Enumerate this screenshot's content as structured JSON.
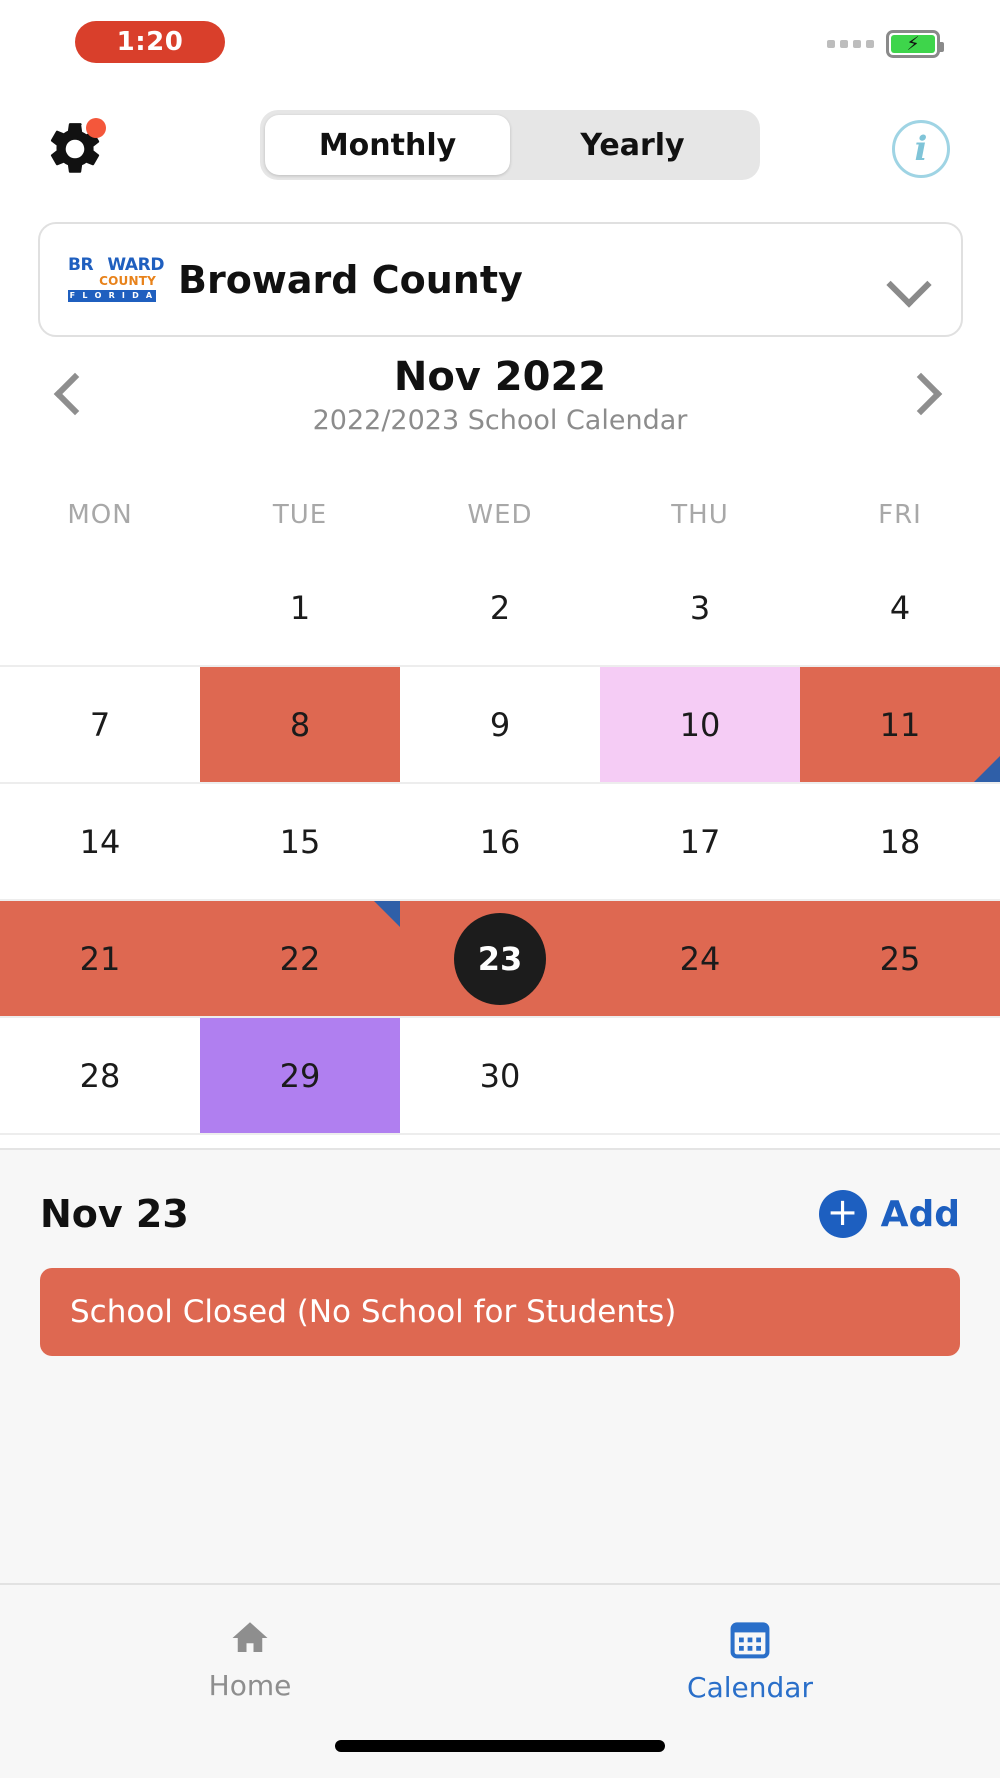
{
  "status_bar": {
    "time": "1:20",
    "time_pill_color": "#D93F2B",
    "battery_color": "#3ED54B",
    "charging": true,
    "signal_dots": 4
  },
  "header": {
    "gear_icon": "gear-icon",
    "gear_badge": true,
    "info_icon": "info-icon",
    "segments": [
      {
        "label": "Monthly",
        "active": true
      },
      {
        "label": "Yearly",
        "active": false
      }
    ]
  },
  "county_selector": {
    "name": "Broward County",
    "logo": {
      "line1": "BR",
      "line1b": "WARD",
      "line2": "COUNTY",
      "line3": "F L O R I D A",
      "blue": "#1F5FBF",
      "orange": "#E8821A",
      "sun": "#FFC214"
    },
    "chevron_icon": "chevron-down-icon"
  },
  "month_nav": {
    "title": "Nov 2022",
    "subtitle": "2022/2023 School Calendar",
    "prev_icon": "chevron-left-icon",
    "next_icon": "chevron-right-icon"
  },
  "calendar": {
    "weekdays": [
      "MON",
      "TUE",
      "WED",
      "THU",
      "FRI"
    ],
    "colors": {
      "coral": "#DE6851",
      "pink": "#F5CCF5",
      "purple": "#B07FF0",
      "selected": "#1C1C1C",
      "marker_blue": "#2F5FA8"
    },
    "weeks": [
      [
        {
          "day": "",
          "bg": "none"
        },
        {
          "day": "1",
          "bg": "none"
        },
        {
          "day": "2",
          "bg": "none"
        },
        {
          "day": "3",
          "bg": "none"
        },
        {
          "day": "4",
          "bg": "none"
        }
      ],
      [
        {
          "day": "7",
          "bg": "none"
        },
        {
          "day": "8",
          "bg": "coral"
        },
        {
          "day": "9",
          "bg": "none"
        },
        {
          "day": "10",
          "bg": "pink"
        },
        {
          "day": "11",
          "bg": "coral",
          "marker": "br"
        }
      ],
      [
        {
          "day": "14",
          "bg": "none"
        },
        {
          "day": "15",
          "bg": "none"
        },
        {
          "day": "16",
          "bg": "none"
        },
        {
          "day": "17",
          "bg": "none"
        },
        {
          "day": "18",
          "bg": "none"
        }
      ],
      [
        {
          "day": "21",
          "bg": "coral"
        },
        {
          "day": "22",
          "bg": "coral",
          "marker": "tr"
        },
        {
          "day": "23",
          "bg": "coral",
          "selected": true
        },
        {
          "day": "24",
          "bg": "coral"
        },
        {
          "day": "25",
          "bg": "coral"
        }
      ],
      [
        {
          "day": "28",
          "bg": "none"
        },
        {
          "day": "29",
          "bg": "purple"
        },
        {
          "day": "30",
          "bg": "none"
        },
        {
          "day": "",
          "bg": "none"
        },
        {
          "day": "",
          "bg": "none"
        }
      ]
    ]
  },
  "event_panel": {
    "date_label": "Nov 23",
    "add_label": "Add",
    "add_icon": "plus-circle-icon",
    "add_color": "#1D5FC0",
    "events": [
      {
        "title": "School Closed (No School for Students)",
        "color": "#DE6851"
      }
    ]
  },
  "tabbar": {
    "tabs": [
      {
        "label": "Home",
        "icon": "home-icon",
        "active": false,
        "color": "#8E8E8E"
      },
      {
        "label": "Calendar",
        "icon": "calendar-icon",
        "active": true,
        "color": "#2A6FC9"
      }
    ]
  }
}
